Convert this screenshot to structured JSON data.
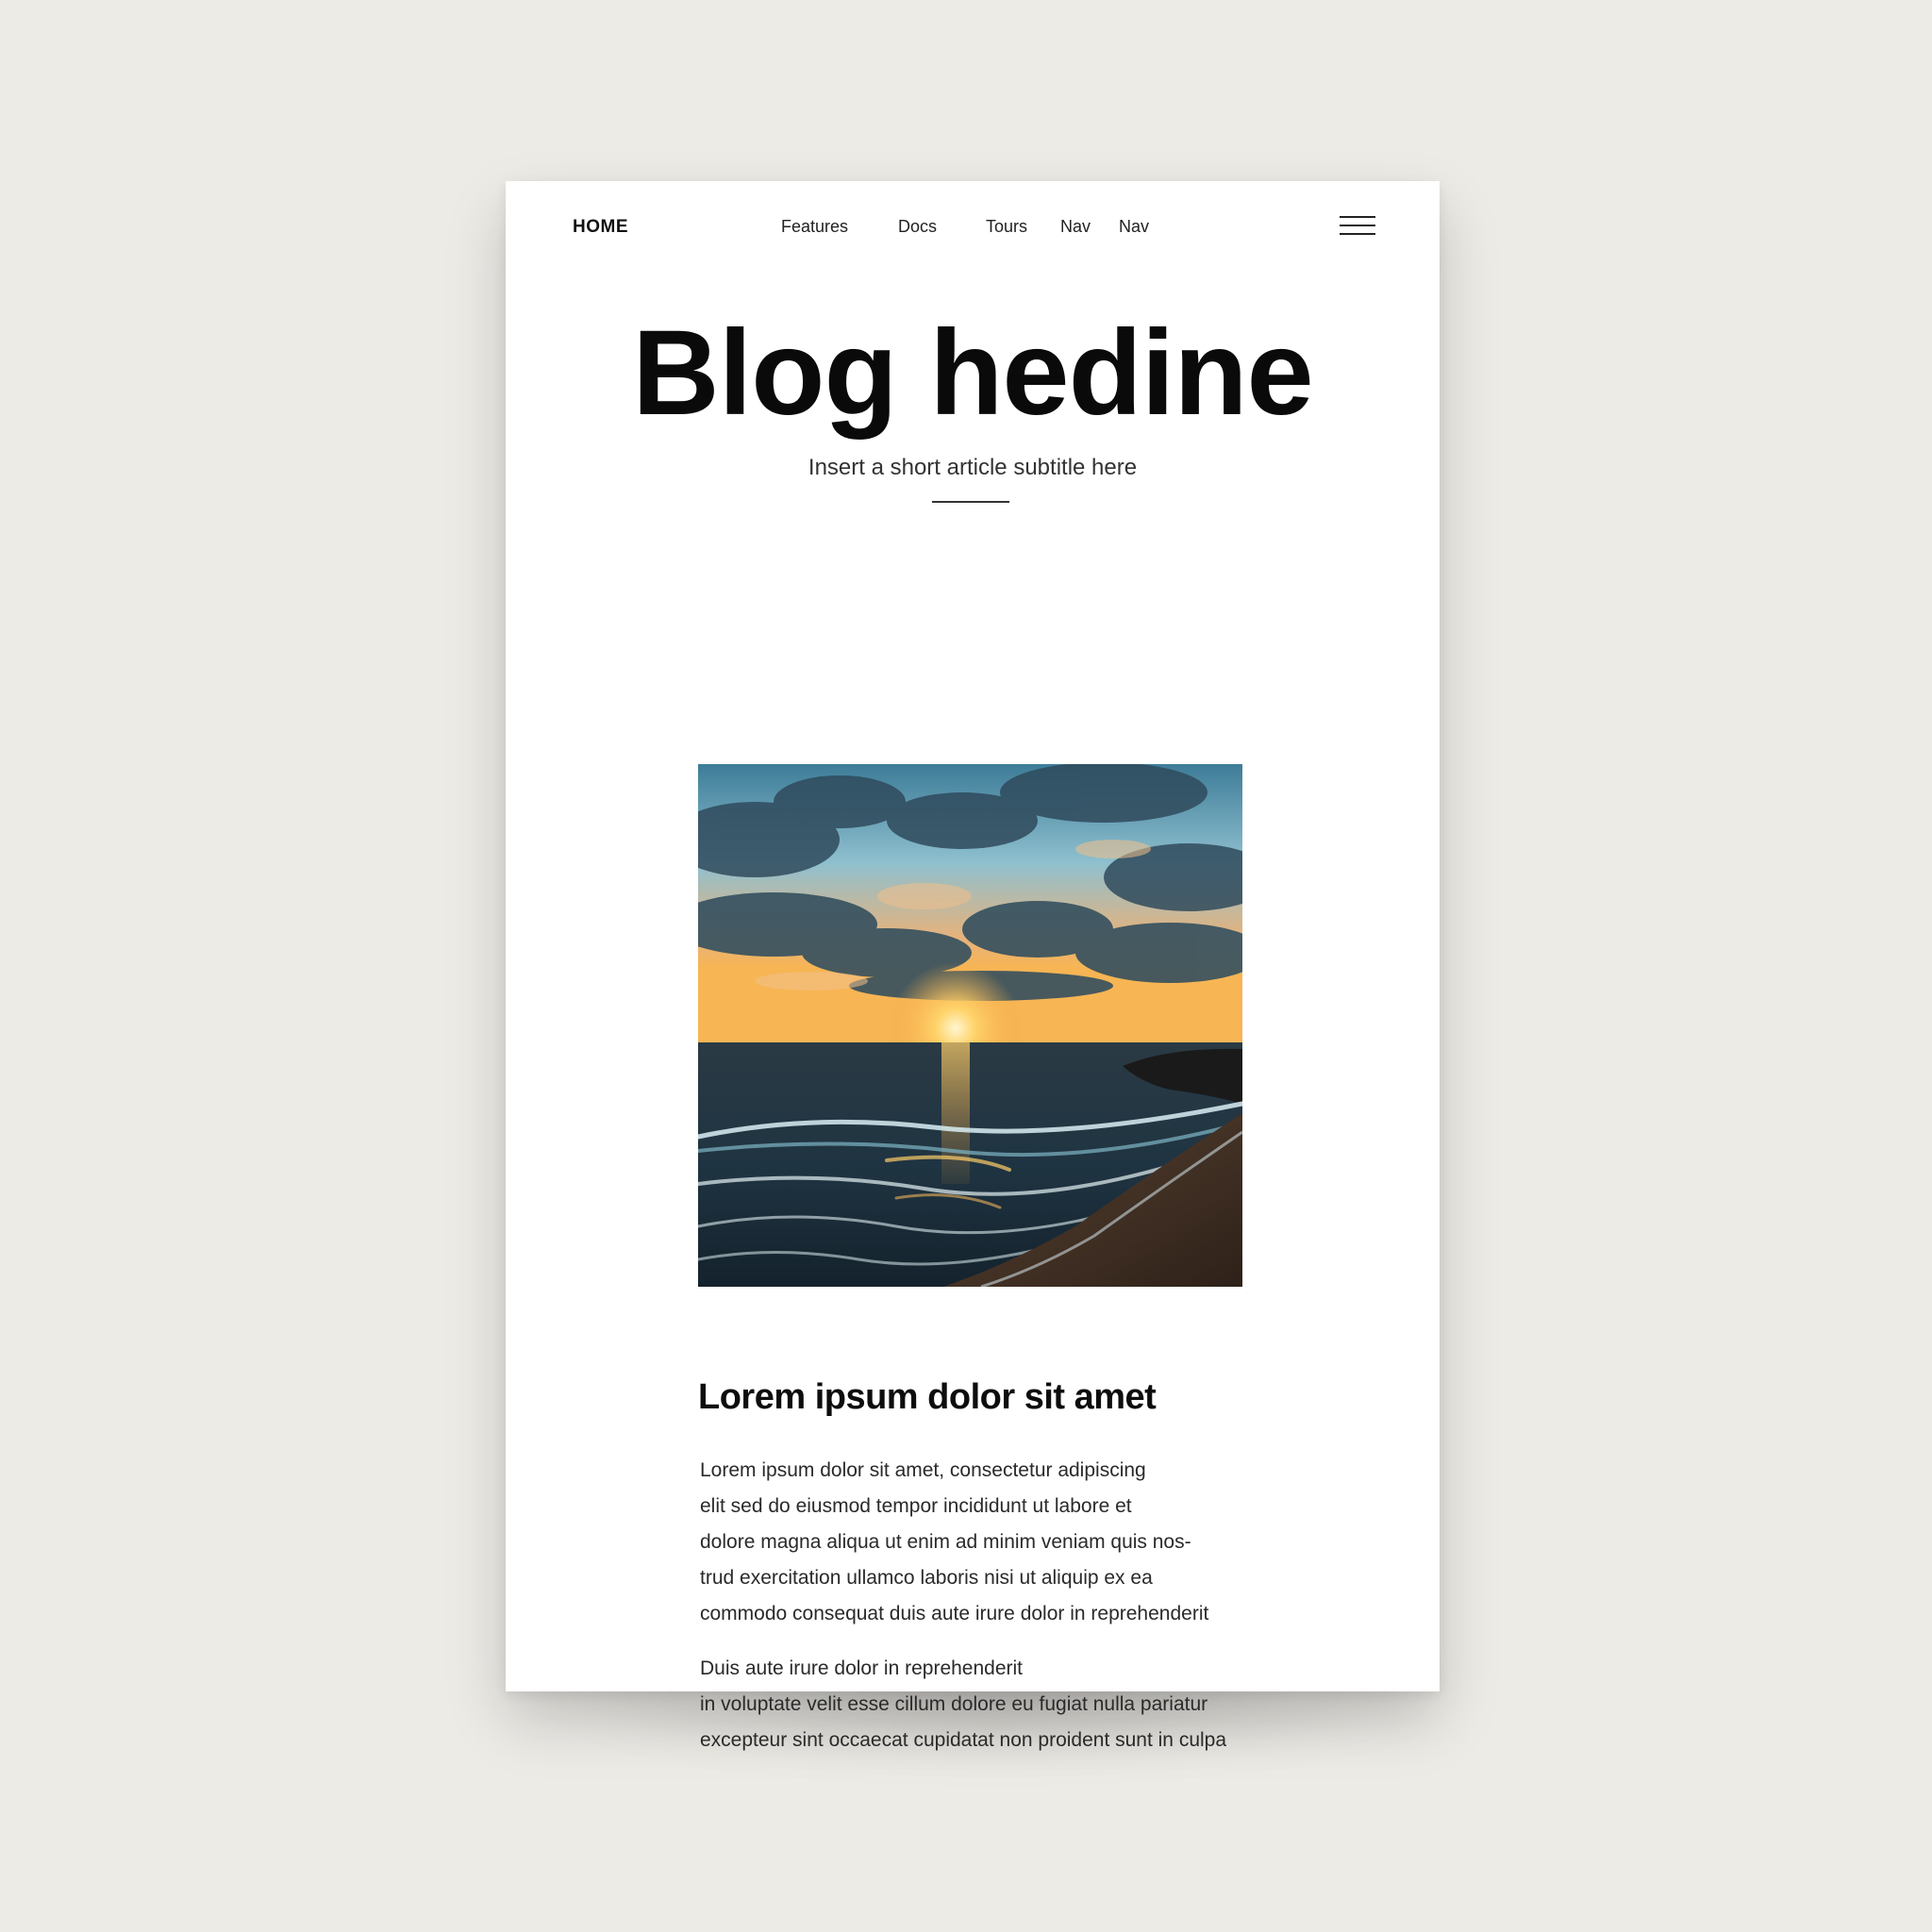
{
  "nav": {
    "logo": "HOME",
    "links": [
      "Features",
      "Docs",
      "Tours",
      "Nav",
      "Nav"
    ],
    "menu_icon": "hamburger-menu-icon"
  },
  "hero": {
    "headline": "Blog hedine",
    "subtitle": "Insert a short article subtitle here"
  },
  "image": {
    "subject": "sunset over ocean waves on a beach"
  },
  "article": {
    "title": "Lorem ipsum dolor sit amet",
    "paragraph1": [
      "Lorem ipsum dolor sit amet, consectetur adipiscing",
      "elit sed do eiusmod tempor incididunt ut labore et",
      "dolore magna aliqua ut enim ad minim veniam quis nos-",
      "trud exercitation ullamco laboris nisi ut aliquip ex ea",
      "commodo consequat duis aute irure dolor in reprehenderit"
    ],
    "paragraph2": [
      "Duis aute irure dolor in reprehenderit",
      "in voluptate velit esse cillum dolore eu fugiat nulla pariatur",
      "excepteur sint occaecat cupidatat non proident sunt in culpa"
    ]
  },
  "colors": {
    "background": "#edebe6",
    "page": "#ffffff",
    "text": "#0a0a0a"
  }
}
